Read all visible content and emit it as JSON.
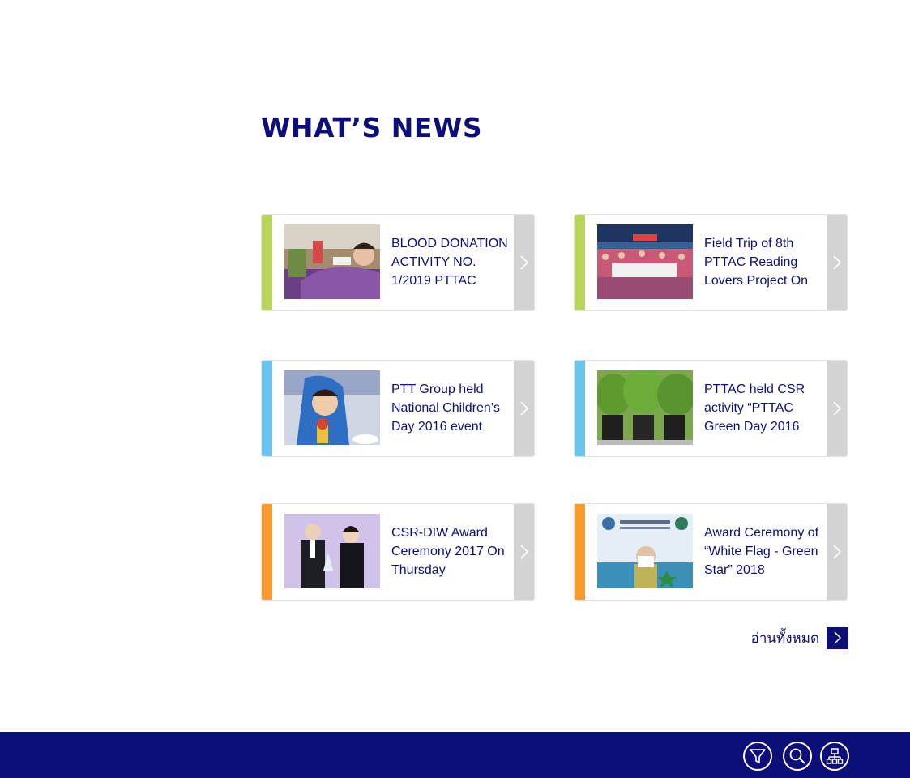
{
  "section": {
    "title": "WHAT’S NEWS"
  },
  "news": [
    {
      "title": "BLOOD DONATION ACTIVITY NO. 1/2019 PTTAC",
      "accent": "#b9d45a",
      "icon": "chevron-right-icon"
    },
    {
      "title": "Field Trip of 8th PTTAC Reading Lovers Project On",
      "accent": "#b9d45a",
      "icon": "chevron-right-icon"
    },
    {
      "title": "PTT Group held National Children’s Day 2016 event",
      "accent": "#6cc3ec",
      "icon": "chevron-right-icon"
    },
    {
      "title": "PTTAC held CSR activity “PTTAC Green Day 2016",
      "accent": "#6cc3ec",
      "icon": "chevron-right-icon"
    },
    {
      "title": "CSR-DIW Award Ceremony 2017 On Thursday",
      "accent": "#f99a2e",
      "icon": "chevron-right-icon"
    },
    {
      "title": "Award Ceremony of “White Flag - Green Star” 2018",
      "accent": "#f99a2e",
      "icon": "chevron-right-icon"
    }
  ],
  "read_all": {
    "label": "อ่านทั้งหมด",
    "icon": "chevron-right-icon"
  },
  "footer": {
    "icons": [
      "filter-icon",
      "search-icon",
      "sitemap-icon"
    ]
  },
  "colors": {
    "brand": "#0d0f78",
    "arrow_bg": "#d3d3d3"
  }
}
